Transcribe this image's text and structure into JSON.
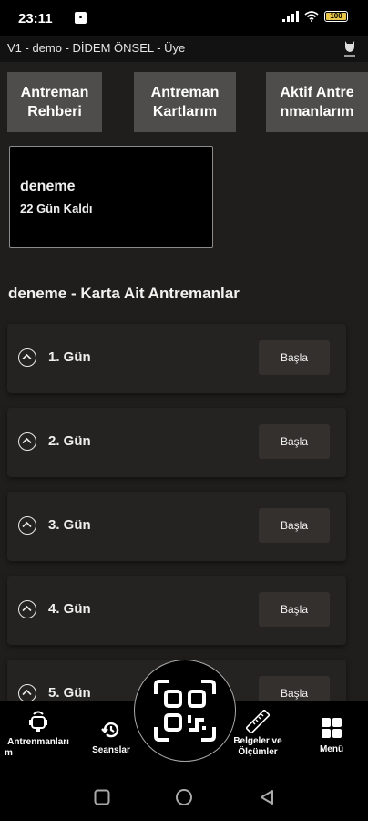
{
  "status_bar": {
    "time": "23:11",
    "battery": "100"
  },
  "header": {
    "title": "V1 - demo - DİDEM ÖNSEL - Üye"
  },
  "tabs": [
    {
      "line1": "Antreman",
      "line2": "Rehberi"
    },
    {
      "line1": "Antreman",
      "line2": "Kartlarım"
    },
    {
      "line1": "Aktif Antre",
      "line2": "nmanlarım"
    }
  ],
  "card": {
    "title": "deneme",
    "subtitle": "22 Gün Kaldı"
  },
  "section_title": "deneme - Karta Ait Antremanlar",
  "days": [
    {
      "label": "1. Gün",
      "button": "Başla"
    },
    {
      "label": "2. Gün",
      "button": "Başla"
    },
    {
      "label": "3. Gün",
      "button": "Başla"
    },
    {
      "label": "4. Gün",
      "button": "Başla"
    },
    {
      "label": "5. Gün",
      "button": "Başla"
    }
  ],
  "bottom_nav": {
    "workouts_line1": "Antrenmanları",
    "workouts_line2": "m",
    "sessions": "Seanslar",
    "docs_line1": "Belgeler ve",
    "docs_line2": "Ölçümler",
    "menu": "Menü"
  },
  "icons": {
    "workouts": "kettlebell-icon",
    "sessions": "history-icon",
    "qr": "qr-scan-icon",
    "docs": "ruler-icon",
    "menu": "grid-icon"
  }
}
